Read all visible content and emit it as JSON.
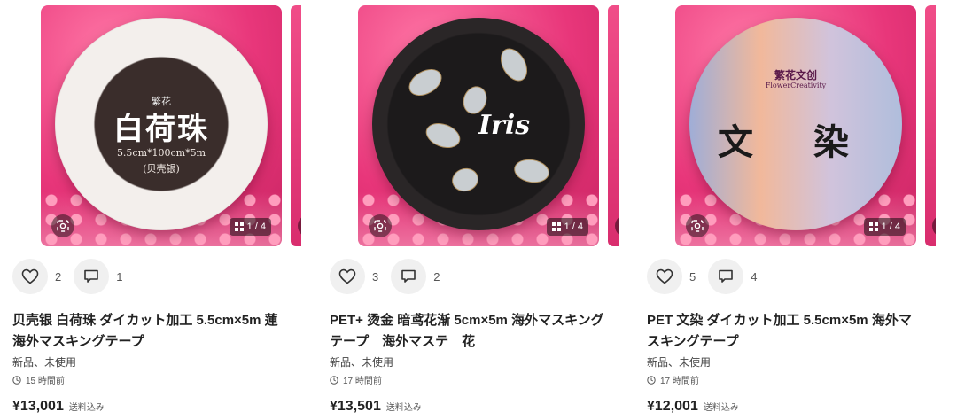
{
  "products": [
    {
      "tape_brand": "繁花",
      "tape_title": "白荷珠",
      "tape_size": "5.5cm*100cm*5m",
      "tape_sub": "(贝壳银)",
      "page_indicator": "1 / 4",
      "likes": "2",
      "comments": "1",
      "title": "贝壳银 白荷珠 ダイカット加工 5.5cm×5m 蓮\n海外マスキングテープ",
      "condition": "新品、未使用",
      "time": "15 時間前",
      "price": "¥13,001",
      "shipping": "送料込み"
    },
    {
      "tape_word": "Iris",
      "page_indicator": "1 / 4",
      "likes": "3",
      "comments": "2",
      "title": "PET+ 烫金 暗鸢花渐 5cm×5m 海外マスキング\nテープ　海外マステ　花",
      "condition": "新品、未使用",
      "time": "17 時間前",
      "price": "¥13,501",
      "shipping": "送料込み"
    },
    {
      "tape_logo": "繁花文创",
      "tape_logo_sub": "FlowerCreativity",
      "tape_kanji_1": "文",
      "tape_kanji_2": "染",
      "page_indicator": "1 / 4",
      "likes": "5",
      "comments": "4",
      "title": "PET 文染 ダイカット加工 5.5cm×5m 海外マ\nスキングテープ",
      "condition": "新品、未使用",
      "time": "17 時間前",
      "price": "¥12,001",
      "shipping": "送料込み"
    }
  ],
  "colors": {
    "accent_pink": "#e8367a",
    "button_bg": "#f0f0f0"
  },
  "icons": {
    "like": "heart-icon",
    "comment": "comment-icon",
    "lens": "lens-search-icon",
    "gallery": "grid-icon",
    "clock": "clock-icon"
  }
}
